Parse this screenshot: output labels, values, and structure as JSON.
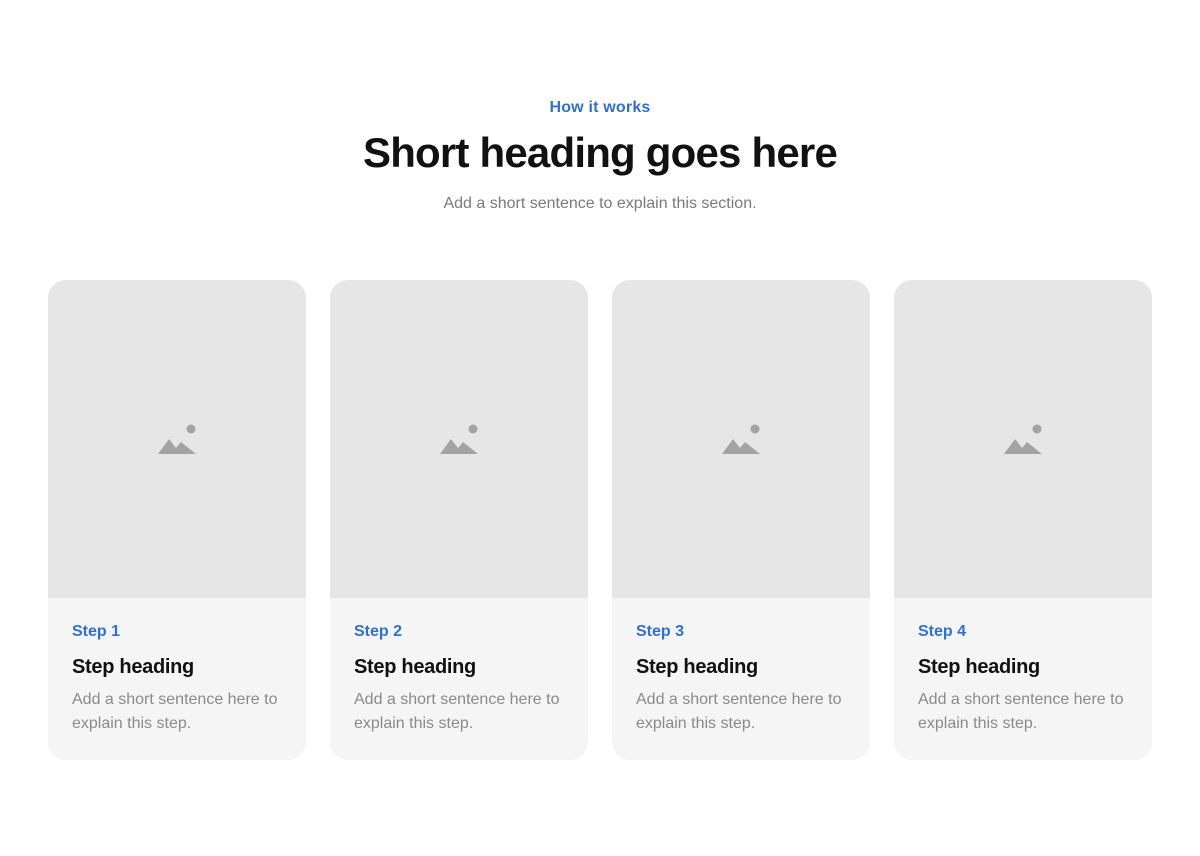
{
  "header": {
    "eyebrow": "How it works",
    "title": "Short heading goes here",
    "subtitle": "Add a short sentence to explain this section."
  },
  "colors": {
    "accent": "#2f6fd8",
    "card_background": "#f5f5f5",
    "placeholder_background": "#e6e6e6",
    "placeholder_icon": "#a3a3a3"
  },
  "steps": [
    {
      "label": "Step 1",
      "heading": "Step heading",
      "description": "Add a short sentence here to explain this step.",
      "image_icon": "image-placeholder-icon"
    },
    {
      "label": "Step 2",
      "heading": "Step heading",
      "description": "Add a short sentence here to explain this step.",
      "image_icon": "image-placeholder-icon"
    },
    {
      "label": "Step 3",
      "heading": "Step heading",
      "description": "Add a short sentence here to explain this step.",
      "image_icon": "image-placeholder-icon"
    },
    {
      "label": "Step 4",
      "heading": "Step heading",
      "description": "Add a short sentence here to explain this step.",
      "image_icon": "image-placeholder-icon"
    }
  ]
}
